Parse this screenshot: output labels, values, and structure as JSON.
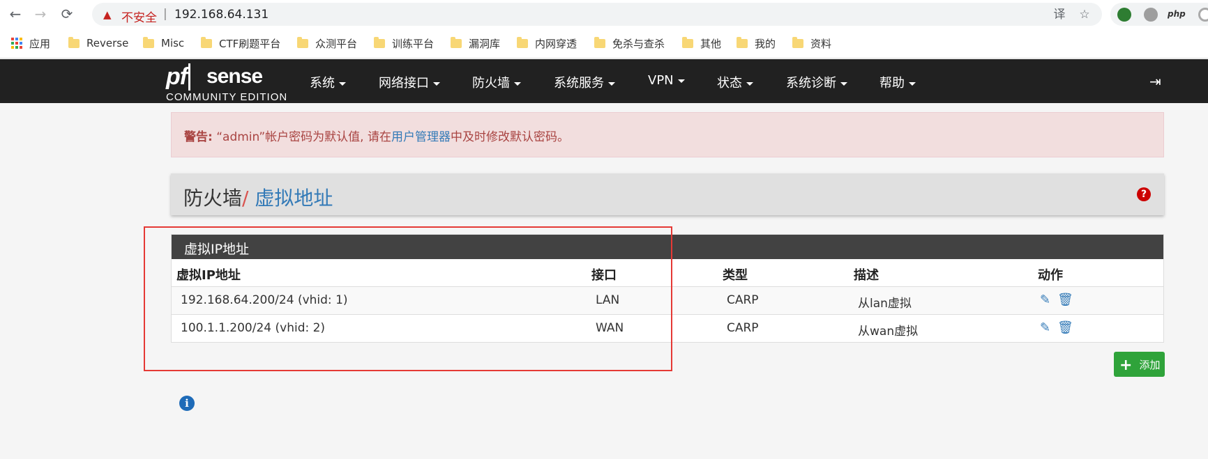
{
  "browser": {
    "insecure_label": "不安全",
    "separator": "|",
    "url": "192.168.64.131",
    "back_icon": "←",
    "forward_icon": "→",
    "reload_icon": "⟳",
    "translate_icon": "译",
    "star_icon": "☆",
    "ext_php": "php"
  },
  "bookmarks": [
    "应用",
    "Reverse",
    "Misc",
    "CTF刷题平台",
    "众测平台",
    "训练平台",
    "漏洞库",
    "内网穿透",
    "免杀与查杀",
    "其他",
    "我的",
    "资料"
  ],
  "navbar": {
    "logo_pf": "pf",
    "logo_sense": "sense",
    "logo_edition": "COMMUNITY EDITION",
    "menu": [
      "系统",
      "网络接口",
      "防火墙",
      "系统服务",
      "VPN",
      "状态",
      "系统诊断",
      "帮助"
    ],
    "logout_icon": "⇥"
  },
  "alert": {
    "prefix": "警告:",
    "text1": " “admin”帐户密码为默认值, 请在",
    "link": "用户管理器",
    "text2": "中及时修改默认密码。"
  },
  "breadcrumb": {
    "parent": "防火墙",
    "slash": "/",
    "current": "虚拟地址",
    "help_icon": "?"
  },
  "panel": {
    "heading": "虚拟IP地址",
    "columns": [
      "虚拟IP地址",
      "接口",
      "类型",
      "描述",
      "动作"
    ],
    "rows": [
      {
        "address": "192.168.64.200/24 (vhid: 1)",
        "interface": "LAN",
        "type": "CARP",
        "description": "从lan虚拟"
      },
      {
        "address": "100.1.1.200/24 (vhid: 2)",
        "interface": "WAN",
        "type": "CARP",
        "description": "从wan虚拟"
      }
    ],
    "edit_icon": "✎",
    "delete_icon": "🗑"
  },
  "add_button": {
    "plus": "+",
    "label": "添加"
  },
  "info_icon": "i",
  "colors": {
    "navbar": "#212121",
    "alert_bg": "#f2dede",
    "panel_heading": "#424242",
    "link": "#337ab7",
    "add_button": "#2fa33a",
    "annotation": "#e53935"
  }
}
